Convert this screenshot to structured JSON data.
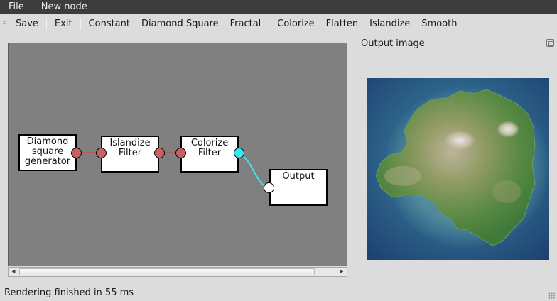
{
  "menubar": {
    "items": [
      "File",
      "New node"
    ]
  },
  "toolbar": {
    "save": "Save",
    "exit": "Exit",
    "constant": "Constant",
    "diamond_square": "Diamond Square",
    "fractal": "Fractal",
    "colorize": "Colorize",
    "flatten": "Flatten",
    "islandize": "Islandize",
    "smooth": "Smooth"
  },
  "graph": {
    "nodes": [
      {
        "id": "diamond",
        "lines": [
          "Diamond",
          "square",
          "generator"
        ]
      },
      {
        "id": "islandize",
        "lines": [
          "Islandize",
          "Filter"
        ]
      },
      {
        "id": "colorize",
        "lines": [
          "Colorize",
          "Filter"
        ]
      },
      {
        "id": "output",
        "lines": [
          "Output"
        ]
      }
    ],
    "colors": {
      "port_red": "#c86262",
      "port_cyan": "#3ce8f0",
      "wire_red": "#b85252",
      "wire_cyan": "#3ce8f0",
      "canvas": "#808080"
    }
  },
  "output_panel": {
    "title": "Output image"
  },
  "status": {
    "text": "Rendering finished in 55 ms"
  },
  "icons": {
    "scroll_left": "◂",
    "scroll_right": "▸",
    "float": "float-icon"
  }
}
